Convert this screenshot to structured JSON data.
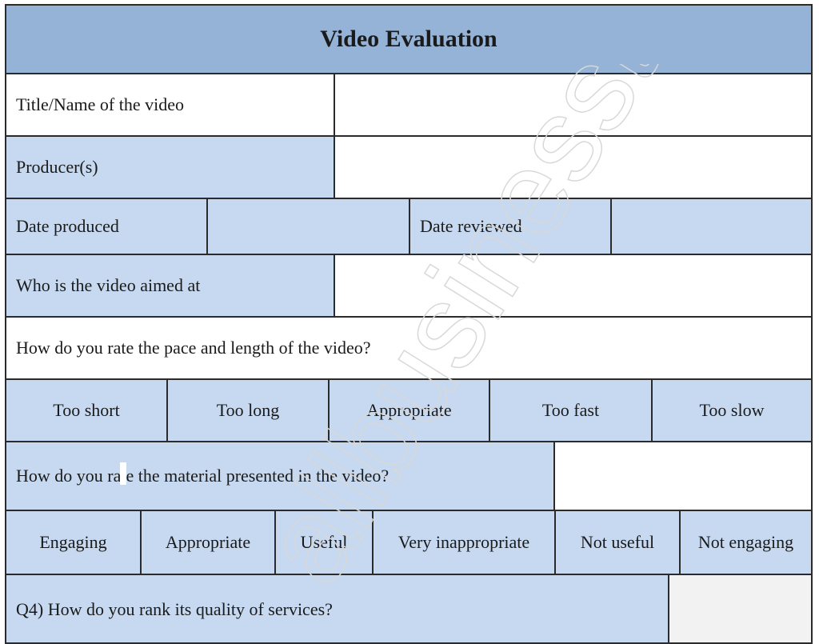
{
  "form": {
    "title": "Video Evaluation",
    "fields": {
      "title_label": "Title/Name of the video",
      "title_value": "",
      "producer_label": "Producer(s)",
      "producer_value": "",
      "date_produced_label": "Date produced",
      "date_produced_value": "",
      "date_reviewed_label": "Date reviewed",
      "date_reviewed_value": "",
      "audience_label": "Who is the video aimed at",
      "audience_value": ""
    },
    "q_pace": {
      "question": "How do you rate the pace and length of the video?",
      "options": [
        "Too short",
        "Too long",
        "Appropriate",
        "Too fast",
        "Too slow"
      ]
    },
    "q_material": {
      "question": "How do you rate the material presented in the video?",
      "answer": "",
      "options": [
        "Engaging",
        "Appropriate",
        "Useful",
        "Very inappropriate",
        "Not useful",
        "Not engaging"
      ]
    },
    "q_quality": {
      "question": "Q4) How do you rank its quality of services?",
      "answer": ""
    }
  },
  "watermark": "allbusinesstemplates",
  "colors": {
    "header": "#95b3d7",
    "label_bg": "#c6d9f0",
    "border": "#2b2b2b"
  }
}
